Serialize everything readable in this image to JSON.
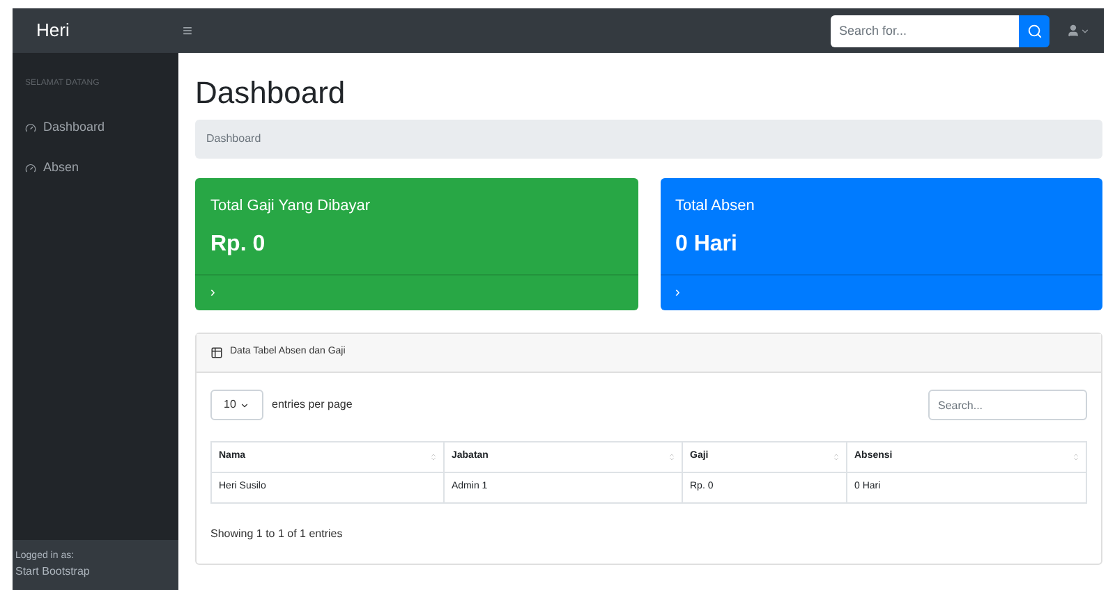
{
  "navbar": {
    "brand": "Heri",
    "toggle": "≡",
    "search": {
      "placeholder": "Search for..."
    }
  },
  "sidebar": {
    "heading": "SELAMAT DATANG",
    "items": [
      {
        "label": "Dashboard"
      },
      {
        "label": "Absen"
      }
    ],
    "footer": {
      "caption": "Logged in as:",
      "name": "Start Bootstrap"
    }
  },
  "page": {
    "title": "Dashboard",
    "breadcrumb": "Dashboard"
  },
  "cards": [
    {
      "title": "Total Gaji Yang Dibayar",
      "value": "Rp. 0",
      "color": "#28a745",
      "link": "›"
    },
    {
      "title": "Total Absen",
      "value": "0 Hari",
      "color": "#007bff",
      "link": "›"
    }
  ],
  "table": {
    "title": "Data Tabel Absen dan Gaji",
    "page_size": "10",
    "page_size_label": "entries per page",
    "search": {
      "placeholder": "Search..."
    },
    "columns": [
      "Nama",
      "Jabatan",
      "Gaji",
      "Absensi"
    ],
    "rows": [
      [
        "Heri Susilo",
        "Admin 1",
        "Rp. 0",
        "0 Hari"
      ]
    ],
    "info": "Showing 1 to 1 of 1 entries"
  }
}
